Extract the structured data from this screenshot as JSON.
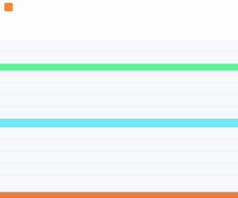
{
  "app": {
    "brand_mark": "",
    "brand_text": ""
  },
  "header": {
    "title": "",
    "subtitle": ""
  },
  "list": {
    "rows": [
      {
        "label": "",
        "variant": "plain"
      },
      {
        "label": "",
        "variant": "plain"
      },
      {
        "label": "",
        "variant": "green"
      },
      {
        "label": "",
        "variant": "plain"
      },
      {
        "label": "",
        "variant": "plain"
      },
      {
        "label": "",
        "variant": "plain"
      },
      {
        "label": "",
        "variant": "plain"
      },
      {
        "label": "",
        "variant": "cyan"
      },
      {
        "label": "",
        "variant": "plain"
      },
      {
        "label": "",
        "variant": "plain"
      },
      {
        "label": "",
        "variant": "plain"
      },
      {
        "label": "",
        "variant": "plain"
      },
      {
        "label": "",
        "variant": "plain"
      }
    ]
  },
  "colors": {
    "accent_orange": "#f28a2e",
    "highlight_green": "#62f49c",
    "highlight_cyan": "#72e6f6",
    "bottom_bar": "#f07a36"
  }
}
